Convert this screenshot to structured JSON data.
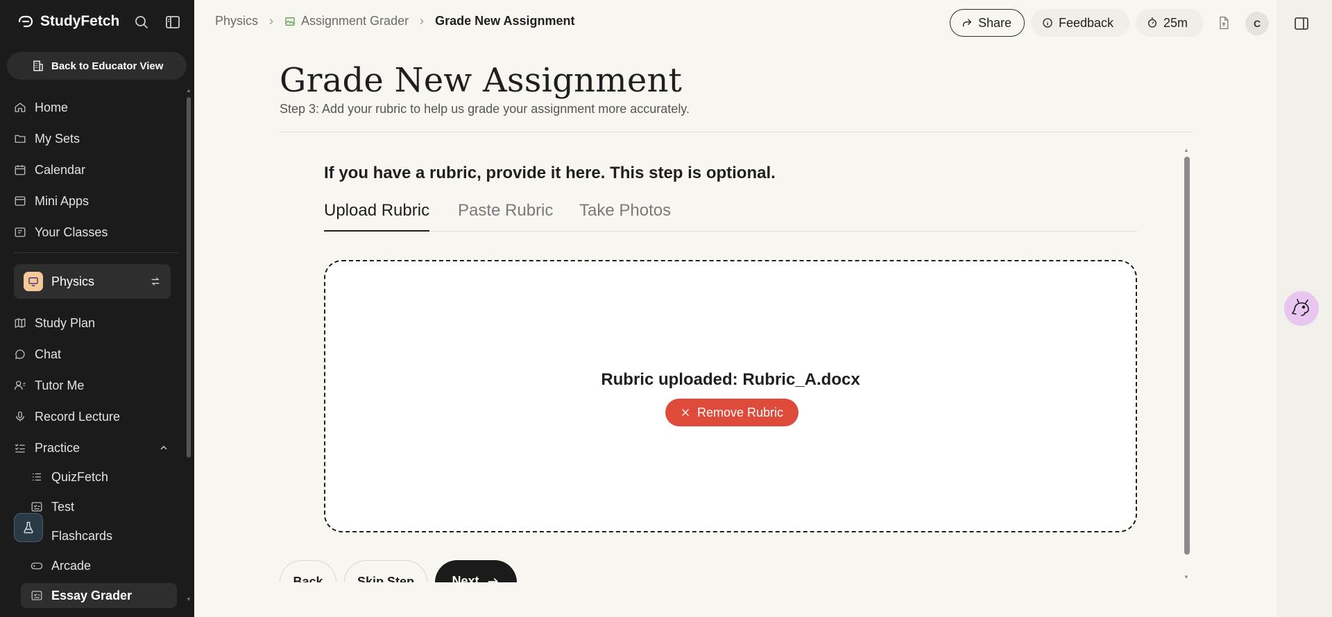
{
  "app": {
    "brand": "StudyFetch"
  },
  "sidebar": {
    "back_label": "Back to Educator View",
    "items": [
      {
        "label": "Home"
      },
      {
        "label": "My Sets"
      },
      {
        "label": "Calendar"
      },
      {
        "label": "Mini Apps"
      },
      {
        "label": "Your Classes"
      }
    ],
    "class_name": "Physics",
    "class_items": [
      {
        "label": "Study Plan"
      },
      {
        "label": "Chat"
      },
      {
        "label": "Tutor Me"
      },
      {
        "label": "Record Lecture"
      },
      {
        "label": "Practice"
      }
    ],
    "practice_items": [
      {
        "label": "QuizFetch"
      },
      {
        "label": "Test"
      },
      {
        "label": "Flashcards"
      },
      {
        "label": "Arcade"
      },
      {
        "label": "Essay Grader"
      }
    ]
  },
  "header": {
    "breadcrumb": [
      "Physics",
      "Assignment Grader",
      "Grade New Assignment"
    ],
    "share_label": "Share",
    "feedback_label": "Feedback",
    "timer_label": "25m",
    "avatar_initial": "C"
  },
  "main": {
    "title": "Grade New Assignment",
    "subtitle": "Step 3: Add your rubric to help us grade your assignment more accurately.",
    "section_title": "If you have a rubric, provide it here. This step is optional.",
    "tabs": [
      {
        "label": "Upload Rubric",
        "active": true
      },
      {
        "label": "Paste Rubric",
        "active": false
      },
      {
        "label": "Take Photos",
        "active": false
      }
    ],
    "uploaded_text": "Rubric uploaded: Rubric_A.docx",
    "remove_label": "Remove Rubric"
  },
  "footer": {
    "back_label": "Back",
    "skip_label": "Skip Step",
    "next_label": "Next"
  },
  "colors": {
    "sidebar_bg": "#1b1b1b",
    "page_bg": "#f7f6f1",
    "danger": "#df4b3a",
    "brand_green": "#5aa04a"
  }
}
